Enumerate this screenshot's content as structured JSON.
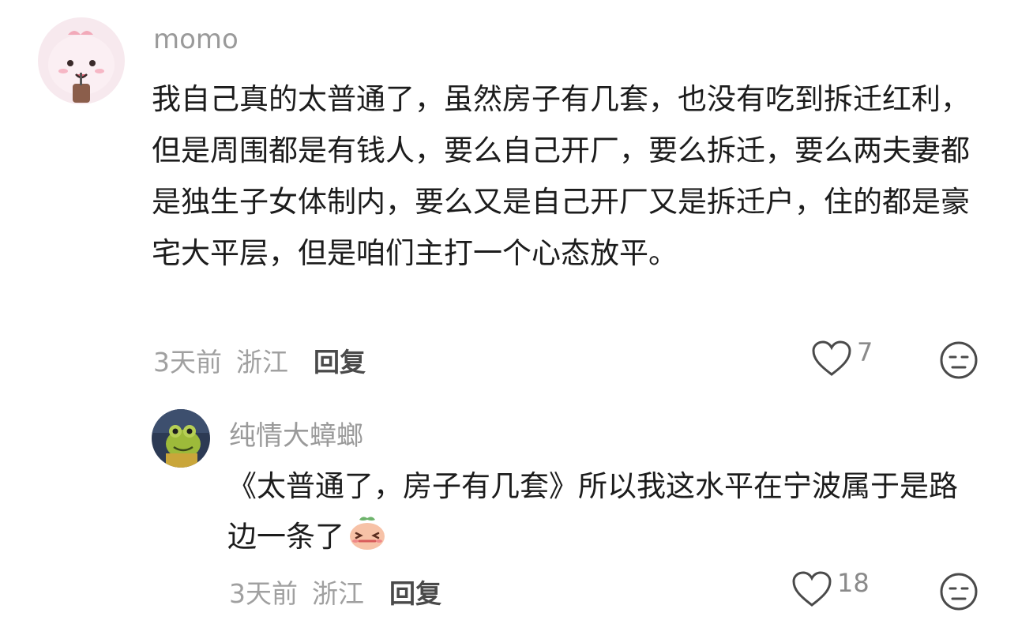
{
  "comments": [
    {
      "username": "momo",
      "text": "我自己真的太普通了，虽然房子有几套，也没有吃到拆迁红利，但是周围都是有钱人，要么自己开厂，要么拆迁，要么两夫妻都是独生子女体制内，要么又是自己开厂又是拆迁户，住的都是豪宅大平层，但是咱们主打一个心态放平。",
      "time": "3天前",
      "location": "浙江",
      "reply_label": "回复",
      "likes": "7",
      "avatar_icon": "cartoon-avatar-icon"
    }
  ],
  "reply": {
    "username": "纯情大蟑螂",
    "text": "《太普通了，房子有几套》所以我这水平在宁波属于是路边一条了",
    "inline_emoji": "embarrassed-face-emoji",
    "time": "3天前",
    "location": "浙江",
    "reply_label": "回复",
    "likes": "18",
    "avatar_icon": "frog-avatar-icon"
  },
  "colors": {
    "username": "#9a9a9a",
    "text": "#1c1c1c",
    "meta": "#a0a0a0",
    "reply_link": "#4a4a4a"
  }
}
